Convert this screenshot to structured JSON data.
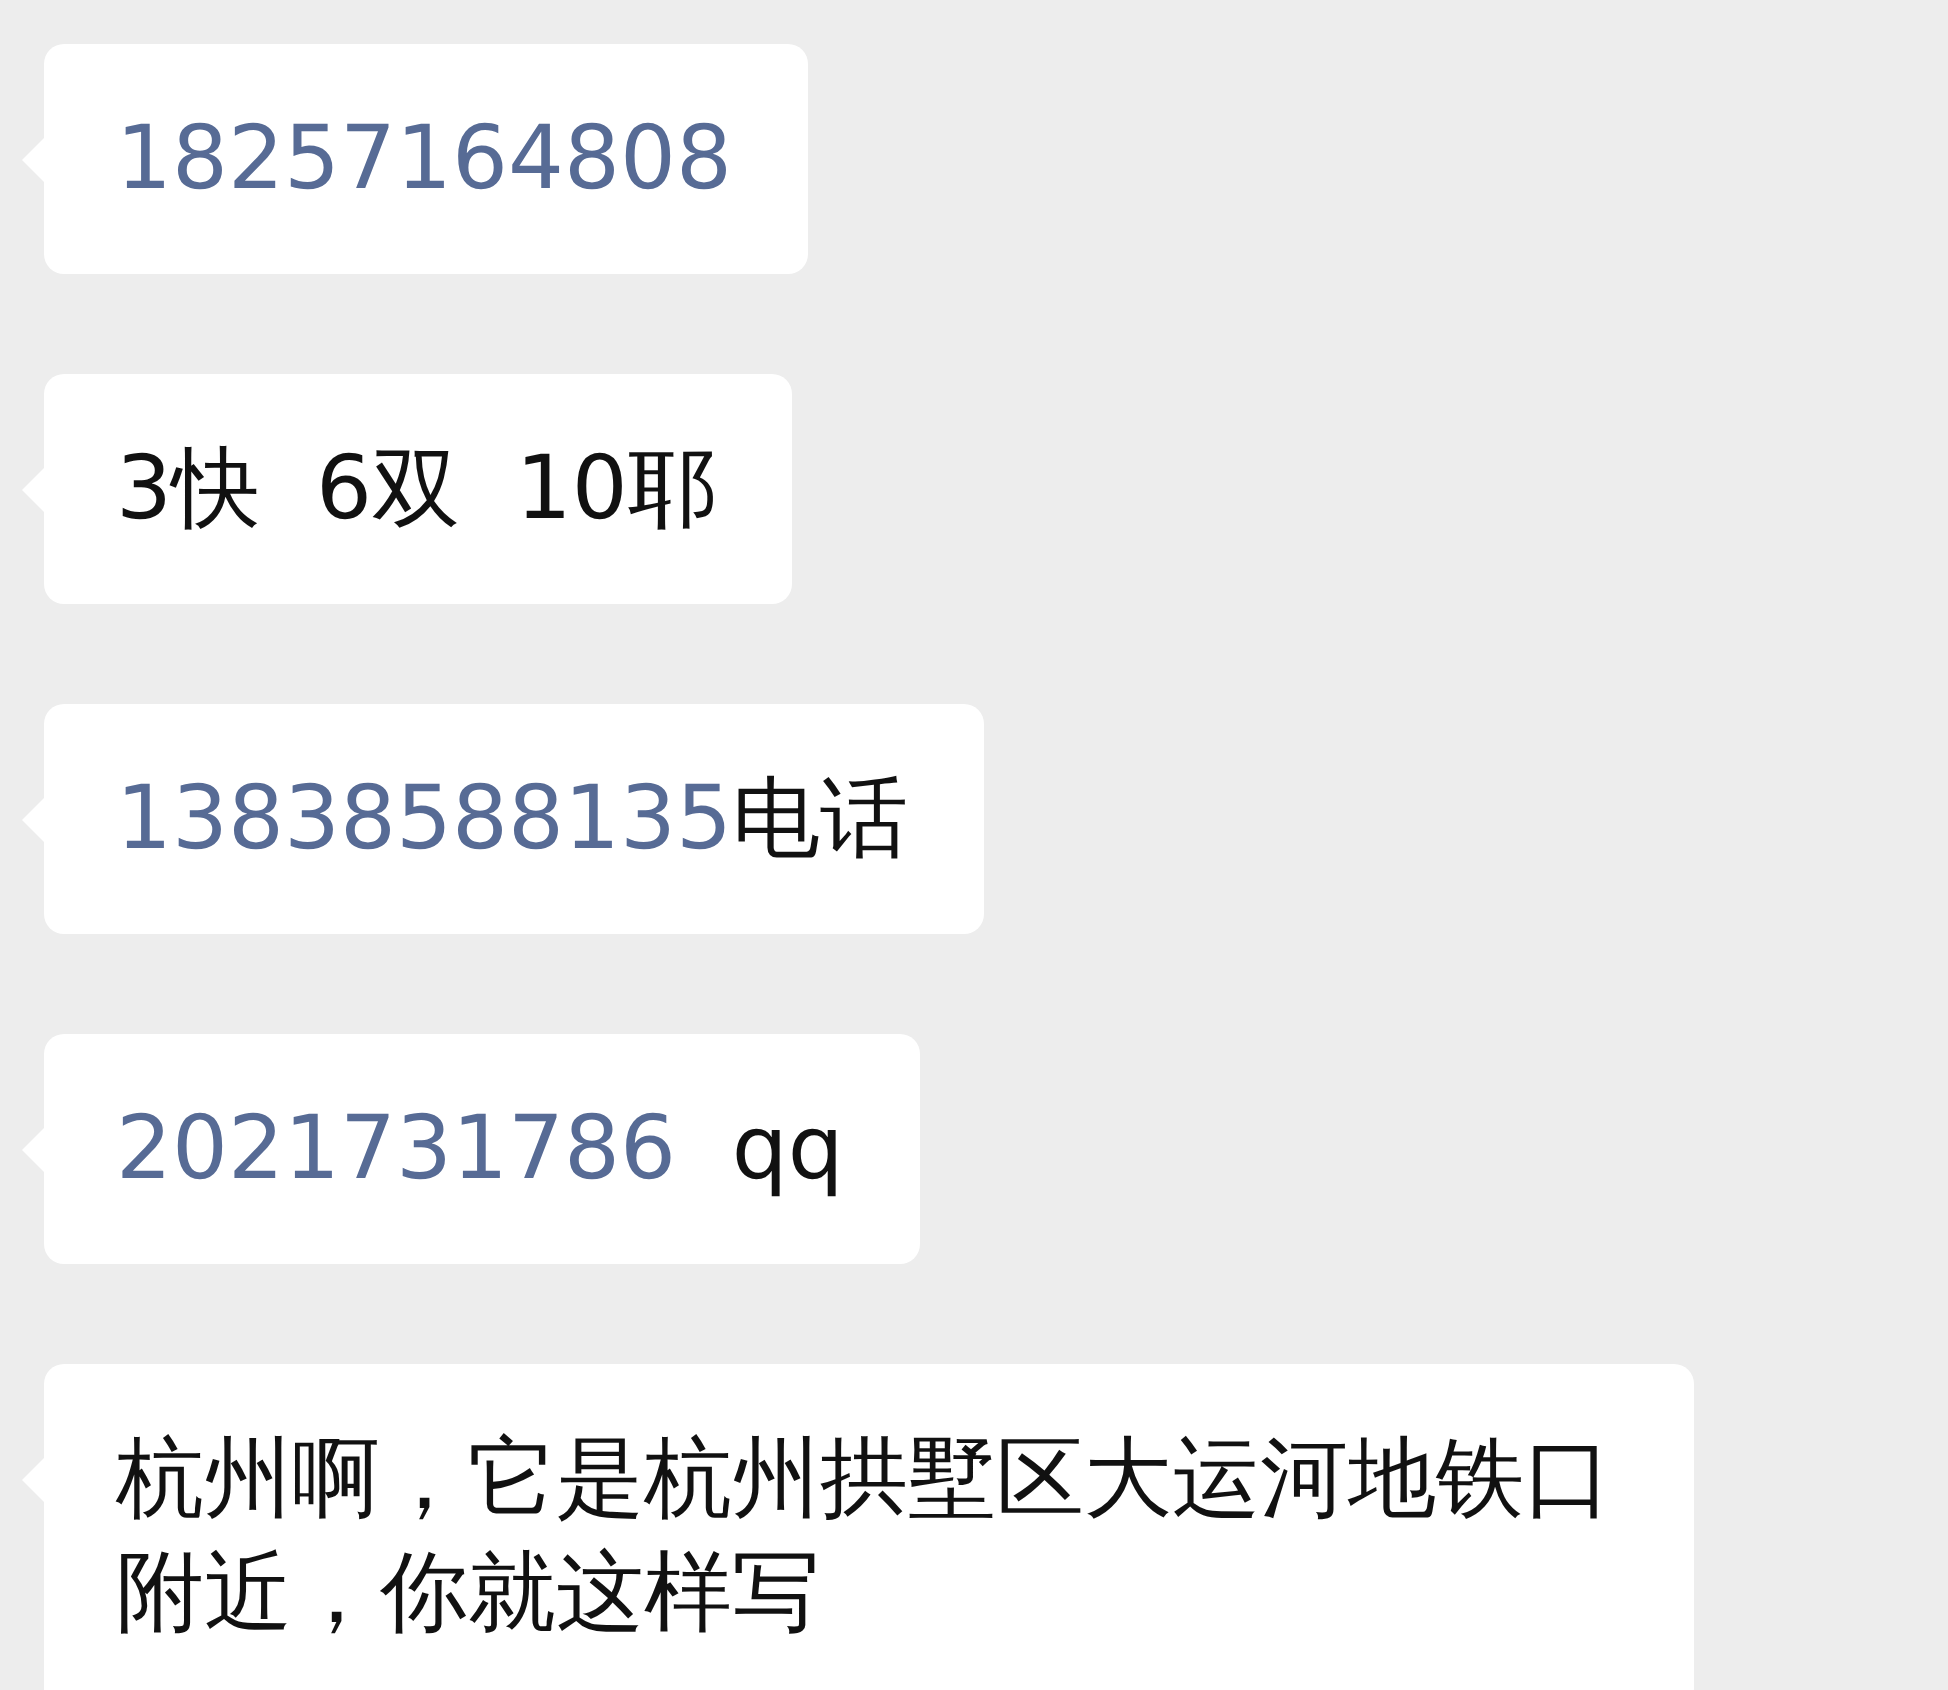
{
  "messages": [
    {
      "segments": [
        {
          "kind": "link",
          "text": "18257164808"
        }
      ]
    },
    {
      "segments": [
        {
          "kind": "plain",
          "text": "3快  6双  10耶"
        }
      ]
    },
    {
      "segments": [
        {
          "kind": "link",
          "text": "13838588135"
        },
        {
          "kind": "plain",
          "text": "电话"
        }
      ]
    },
    {
      "segments": [
        {
          "kind": "link",
          "text": "2021731786"
        },
        {
          "kind": "plain",
          "text": "  qq"
        }
      ]
    },
    {
      "segments": [
        {
          "kind": "plain",
          "text": "杭州啊，它是杭州拱墅区大运河地铁口附近，你就这样写"
        }
      ]
    }
  ]
}
